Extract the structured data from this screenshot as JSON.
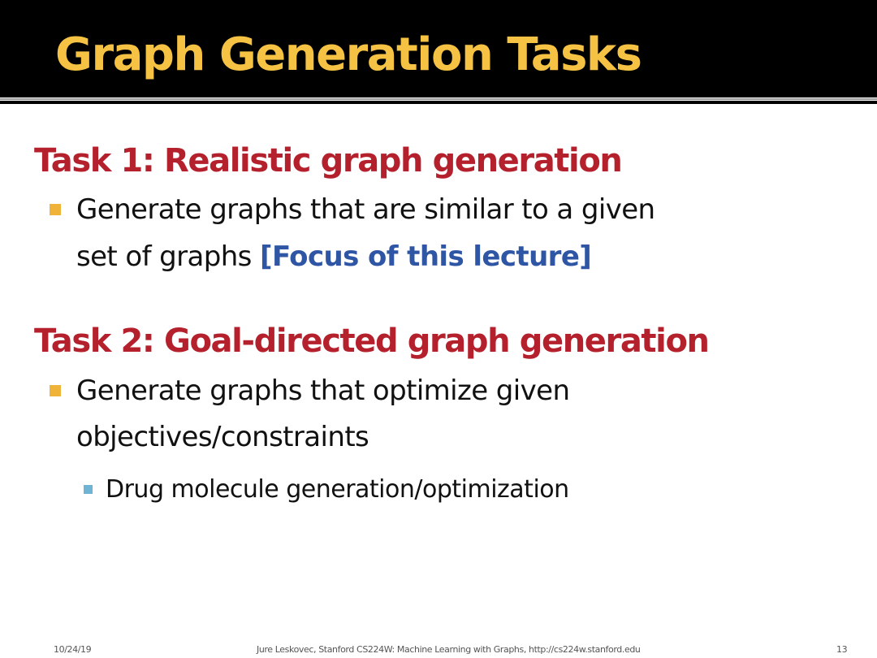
{
  "slide": {
    "title": "Graph Generation Tasks",
    "tasks": [
      {
        "heading": "Task 1: Realistic graph generation",
        "bullet_line1": "Generate graphs that are similar to a given",
        "bullet_line2_prefix": "set of graphs ",
        "bullet_line2_emphasis": "[Focus of this lecture]"
      },
      {
        "heading": "Task 2: Goal-directed graph generation",
        "bullet_line1": "Generate graphs that optimize given",
        "bullet_line2": "objectives/constraints",
        "sub_bullet": "Drug molecule generation/optimization"
      }
    ]
  },
  "footer": {
    "date": "10/24/19",
    "credit": "Jure Leskovec, Stanford CS224W: Machine Learning with Graphs, http://cs224w.stanford.edu",
    "page_number": "13"
  },
  "colors": {
    "title": "#f6c243",
    "heading": "#b5202d",
    "emphasis": "#2f56a5",
    "bullet": "#f0b339",
    "sub_bullet": "#6fb4d4"
  }
}
